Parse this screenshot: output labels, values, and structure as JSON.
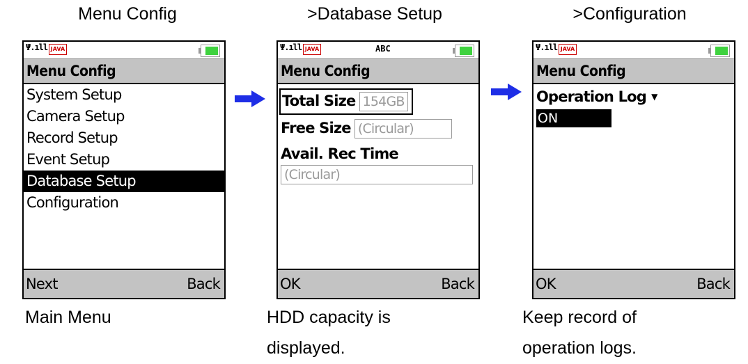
{
  "captions_top": [
    "Menu Config",
    ">Database Setup",
    ">Configuration"
  ],
  "phones": [
    {
      "abc": "",
      "java": "JAVA",
      "title": "Menu Config",
      "menu_items": [
        "System Setup",
        "Camera Setup",
        "Record Setup",
        "Event Setup",
        "Database Setup",
        "Configuration"
      ],
      "selected_index": 4,
      "left_soft": "Next",
      "right_soft": "Back"
    },
    {
      "abc": "ABC",
      "java": "JAVA",
      "title": "Menu Config",
      "total_size_label": "Total Size",
      "total_size_value": "154GB",
      "free_size_label": "Free Size",
      "free_size_value": "(Circular)",
      "avail_label": "Avail. Rec Time",
      "avail_value": "(Circular)",
      "left_soft": "OK",
      "right_soft": "Back"
    },
    {
      "abc": "",
      "java": "JAVA",
      "title": "Menu Config",
      "op_log_label": "Operation Log",
      "op_log_value": "ON",
      "left_soft": "OK",
      "right_soft": "Back"
    }
  ],
  "captions_bottom": [
    {
      "line1": "Main Menu",
      "line2": ""
    },
    {
      "line1": "HDD capacity is",
      "line2": "displayed."
    },
    {
      "line1": "Keep record of",
      "line2": "operation logs."
    }
  ],
  "signal": "Ψ.ıll",
  "colors": {
    "arrow": "#1e2ee6",
    "battery": "#3fd23f",
    "bar": "#c3c3c3"
  }
}
